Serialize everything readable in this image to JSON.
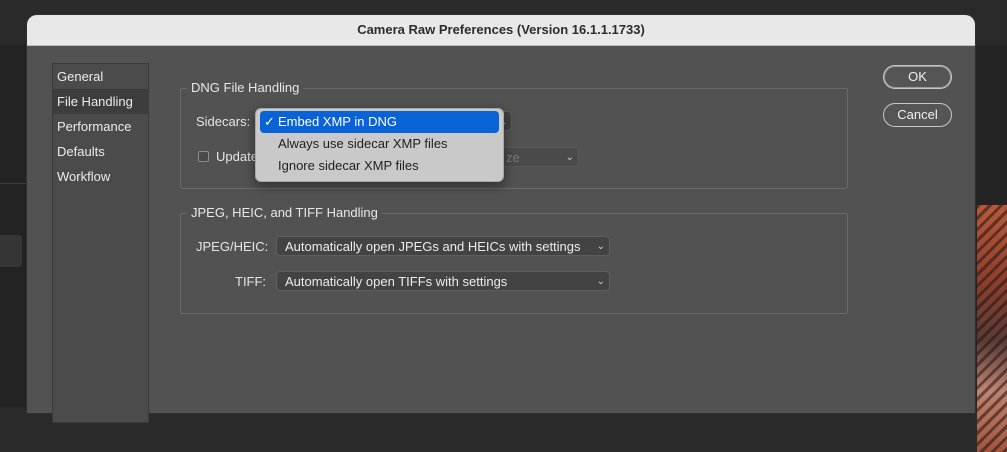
{
  "window": {
    "title": "Camera Raw Preferences  (Version 16.1.1.1733)"
  },
  "nav": {
    "items": [
      {
        "label": "General"
      },
      {
        "label": "File Handling",
        "selected": true
      },
      {
        "label": "Performance"
      },
      {
        "label": "Defaults"
      },
      {
        "label": "Workflow"
      }
    ]
  },
  "dng": {
    "title": "DNG File Handling",
    "sidecars_label": "Sidecars:",
    "update_label": "Update",
    "update_checked": false,
    "preview_value_partial": "ze"
  },
  "popup": {
    "options": [
      {
        "label": "Embed XMP in DNG",
        "selected": true,
        "check": "✓"
      },
      {
        "label": "Always use sidecar XMP files",
        "selected": false,
        "check": ""
      },
      {
        "label": "Ignore sidecar XMP files",
        "selected": false,
        "check": ""
      }
    ]
  },
  "jpeg": {
    "title": "JPEG, HEIC, and TIFF Handling",
    "jpeg_label": "JPEG/HEIC:",
    "jpeg_value": "Automatically open JPEGs and HEICs with settings",
    "tiff_label": "TIFF:",
    "tiff_value": "Automatically open TIFFs with settings"
  },
  "buttons": {
    "ok": "OK",
    "cancel": "Cancel"
  },
  "colors": {
    "accent": "#0a63d6",
    "dialog_bg": "#525252",
    "titlebar_bg": "#e8e8e8"
  }
}
